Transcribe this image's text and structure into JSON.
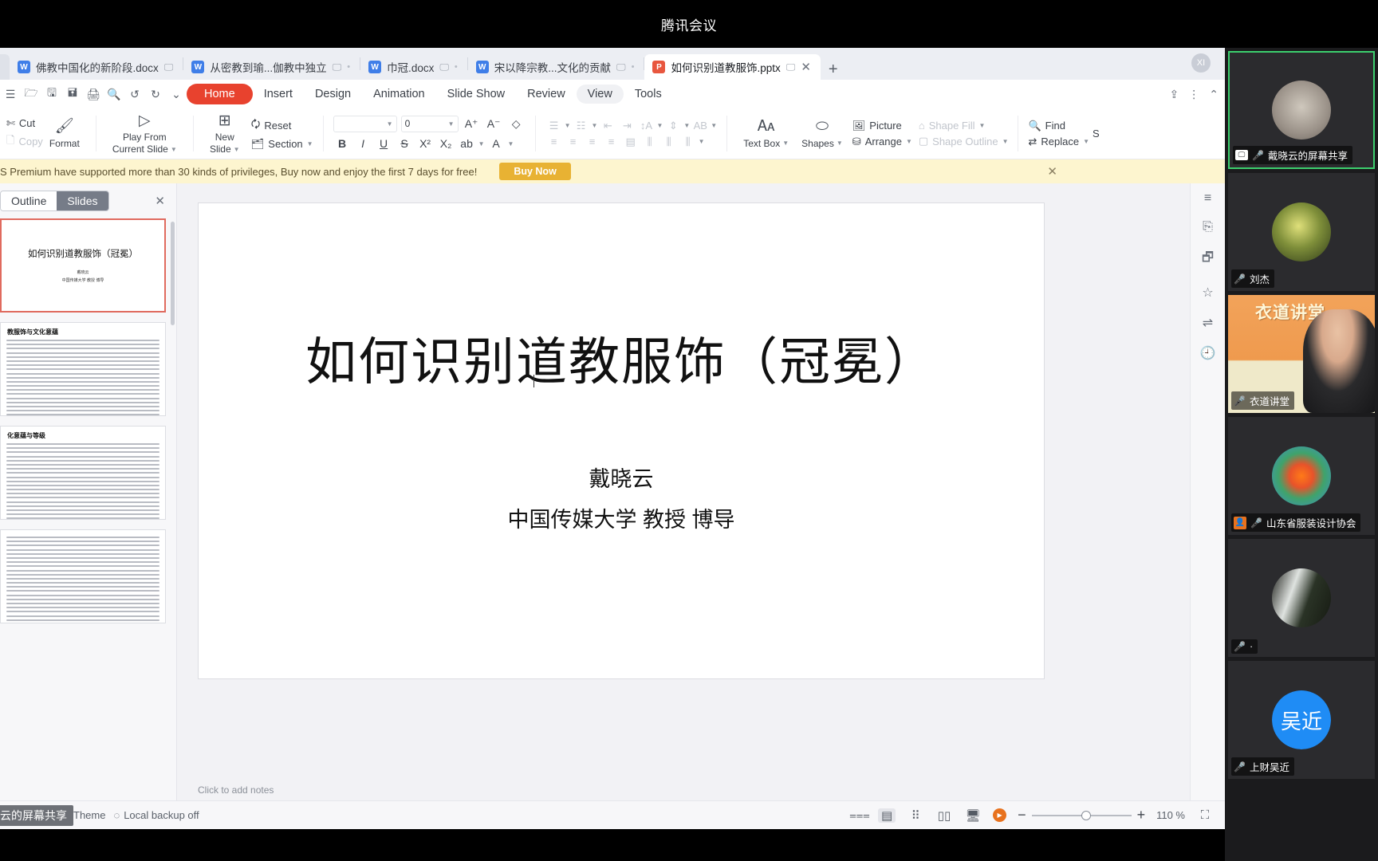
{
  "meeting": {
    "title": "腾讯会议"
  },
  "tabs": [
    {
      "label": "佛教中国化的新阶段.docx",
      "type": "docx",
      "active": false
    },
    {
      "label": "从密教到瑜...伽教中独立",
      "type": "docx",
      "active": false
    },
    {
      "label": "巾冠.docx",
      "type": "docx",
      "active": false
    },
    {
      "label": "宋以降宗教...文化的贡献",
      "type": "docx",
      "active": false
    },
    {
      "label": "如何识别道教服饰.pptx",
      "type": "pptx",
      "active": true
    }
  ],
  "tab_controls": {
    "new_tab": "+",
    "close": "✕",
    "avatar": "XI"
  },
  "menu": {
    "quick_icons": [
      "menu-icon",
      "folder-open-icon",
      "save-icon",
      "save-as-icon",
      "print-icon",
      "print-preview-icon",
      "undo-icon",
      "redo-icon",
      "more-icon"
    ],
    "items": [
      {
        "label": "Home",
        "state": "active"
      },
      {
        "label": "Insert",
        "state": "normal"
      },
      {
        "label": "Design",
        "state": "normal"
      },
      {
        "label": "Animation",
        "state": "normal"
      },
      {
        "label": "Slide Show",
        "state": "normal"
      },
      {
        "label": "Review",
        "state": "normal"
      },
      {
        "label": "View",
        "state": "selected"
      },
      {
        "label": "Tools",
        "state": "normal"
      }
    ],
    "right_icons": [
      "share-icon",
      "more-vertical-icon",
      "collapse-ribbon-icon"
    ]
  },
  "ribbon": {
    "clipboard": {
      "cut": "Cut",
      "copy": "Copy",
      "format": "Format"
    },
    "play": {
      "line1": "Play From",
      "line2": "Current Slide"
    },
    "new_slide": {
      "line1": "New",
      "line2": "Slide"
    },
    "reset": "Reset",
    "section": "Section",
    "font": {
      "name": "",
      "size": "0"
    },
    "font_buttons": [
      "A↑",
      "A↓",
      "clear-format"
    ],
    "text_style": [
      "B",
      "I",
      "U",
      "S",
      "X²",
      "X₂",
      "highlight",
      "font-color"
    ],
    "text_box": "Text Box",
    "shapes": "Shapes",
    "picture": "Picture",
    "arrange": "Arrange",
    "shape_fill": "Shape Fill",
    "shape_outline": "Shape Outline",
    "find": "Find",
    "replace": "Replace",
    "select": "S"
  },
  "promo": {
    "text": "S Premium have supported more than 30 kinds of privileges,  Buy now and enjoy the first 7 days for free!",
    "button": "Buy Now",
    "close": "✕"
  },
  "panel": {
    "tab_outline": "Outline",
    "tab_slides": "Slides",
    "close": "✕",
    "thumbnails": [
      {
        "title": "如何识别道教服饰（冠冕）",
        "sub1": "戴晓云",
        "sub2": "中国传媒大学 教授 博导",
        "selected": true
      },
      {
        "title": "教服饰与文化意蕴",
        "selected": false
      },
      {
        "title": "化意蕴与等级",
        "selected": false
      },
      {
        "title": "",
        "selected": false
      }
    ]
  },
  "slide": {
    "title": "如何识别道教服饰（冠冕）",
    "author": "戴晓云",
    "affiliation": "中国传媒大学 教授 博导",
    "notes_placeholder": "Click to add notes"
  },
  "rail_icons": [
    "properties-icon",
    "layers-icon",
    "star-icon",
    "transition-icon",
    "history-icon"
  ],
  "status": {
    "share_pill": "云的屏幕共享",
    "theme": "Theme",
    "backup": "Local backup off",
    "view_icons": [
      "outline-view-icon",
      "normal-view-icon",
      "slide-sorter-icon",
      "reading-view-icon",
      "presenter-view-icon",
      "play-icon"
    ],
    "zoom_out": "−",
    "zoom_in": "+",
    "zoom_level": "110 %",
    "fit_icon": "fit-to-window-icon"
  },
  "participants": [
    {
      "name": "戴晓云的屏幕共享",
      "mic": "on",
      "speaking": true,
      "avatar": "ph1",
      "badge": "share"
    },
    {
      "name": "刘杰",
      "mic": "off",
      "speaking": false,
      "avatar": "ph2",
      "badge": "none"
    },
    {
      "name": "衣道讲堂",
      "mic": "off",
      "speaking": false,
      "avatar": "poster",
      "badge": "none",
      "poster_text": "衣道讲堂"
    },
    {
      "name": "山东省服装设计协会",
      "mic": "off",
      "speaking": false,
      "avatar": "ph4",
      "badge": "host"
    },
    {
      "name": "·",
      "mic": "off",
      "speaking": false,
      "avatar": "ph5",
      "badge": "none"
    },
    {
      "name": "上财吴近",
      "mic": "off",
      "speaking": false,
      "avatar": "initial",
      "initials": "吴近",
      "badge": "none"
    }
  ],
  "colors": {
    "accent_red": "#e8422e",
    "promo_bg": "#fdf5cf",
    "buy_btn": "#e8b233",
    "speaking_green": "#3ccf6e",
    "mic_off_red": "#e05b4f",
    "strip_bg": "#1b1b1d"
  }
}
